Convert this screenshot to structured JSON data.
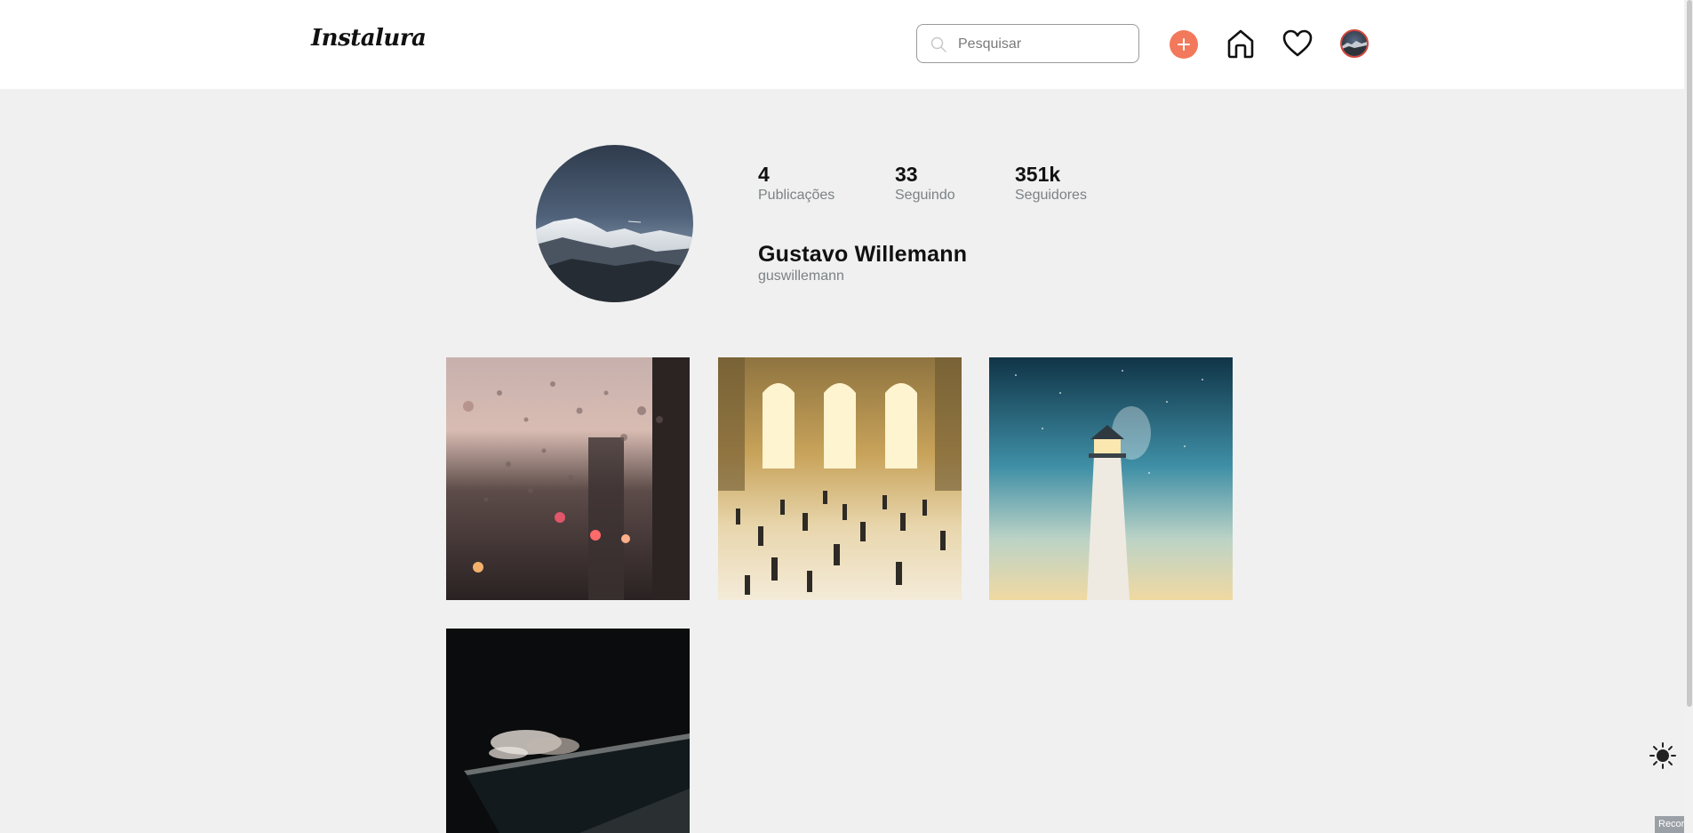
{
  "header": {
    "logo": "Instalura",
    "search": {
      "placeholder": "Pesquisar",
      "value": "",
      "icon": "search-icon"
    },
    "add_button": {
      "icon": "plus-icon",
      "color": "#f2795b"
    },
    "home_icon": "home-icon",
    "likes_icon": "heart-icon",
    "avatar_border_color": "#d2463c"
  },
  "profile": {
    "photo": "mountain-photo",
    "stats": [
      {
        "value": "4",
        "label": "Publicações"
      },
      {
        "value": "33",
        "label": "Seguindo"
      },
      {
        "value": "351k",
        "label": "Seguidores"
      }
    ],
    "name": "Gustavo Willemann",
    "username": "guswillemann"
  },
  "posts": [
    {
      "subject": "rainy-window-photo"
    },
    {
      "subject": "grand-central-terminal-photo"
    },
    {
      "subject": "lighthouse-photo"
    },
    {
      "subject": "night-waves-pool-photo"
    }
  ],
  "theme_toggle": {
    "icon": "sun-icon"
  },
  "recorder_tab": {
    "label": "Recording"
  },
  "colors": {
    "background": "#f0f0f0",
    "header": "#ffffff",
    "accent": "#f2795b",
    "muted_text": "#7b8285"
  }
}
